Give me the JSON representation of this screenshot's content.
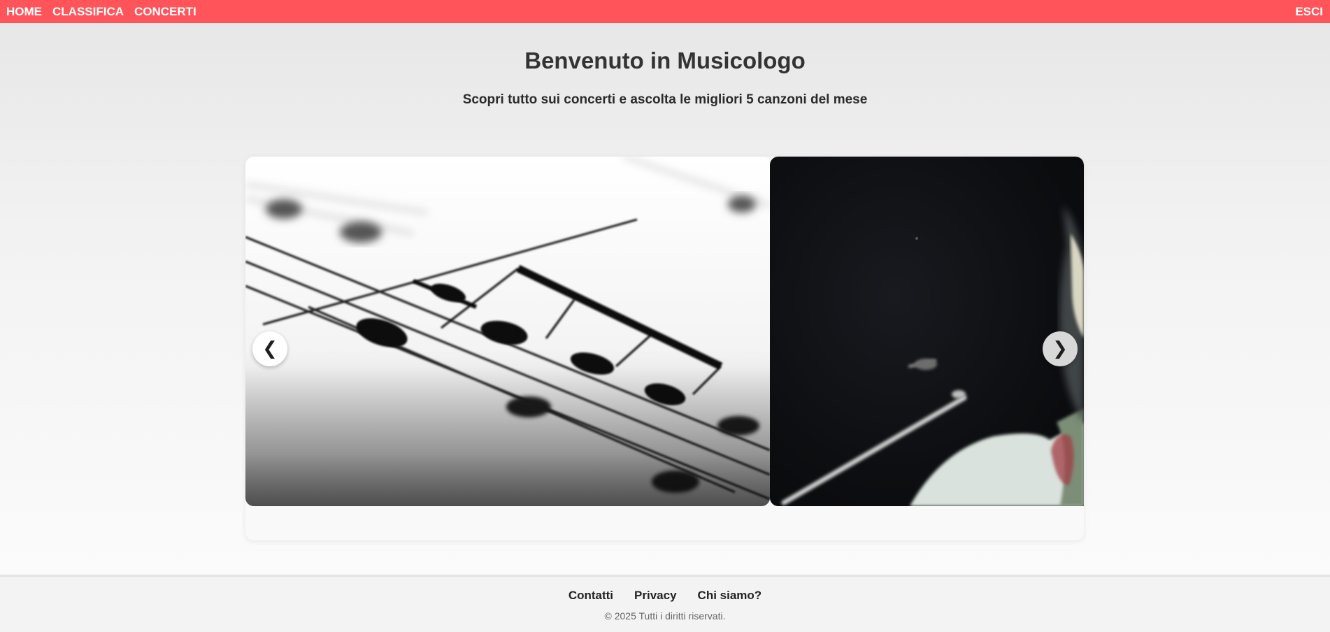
{
  "navbar": {
    "color": "#ff5459",
    "links": [
      "HOME",
      "CLASSIFICA",
      "CONCERTI"
    ],
    "logout_label": "ESCI"
  },
  "header": {
    "title": "Benvenuto in Musicologo",
    "subtitle": "Scopri tutto sui concerti e ascolta le migliori 5 canzoni del mese"
  },
  "carousel": {
    "prev_icon": "❮",
    "next_icon": "❯",
    "slides": [
      {
        "subject": "sheet music"
      },
      {
        "subject": "concert performer"
      }
    ]
  },
  "footer": {
    "links": [
      "Contatti",
      "Privacy",
      "Chi siamo?"
    ],
    "copyright": "© 2025 Tutti i diritti riservati."
  }
}
